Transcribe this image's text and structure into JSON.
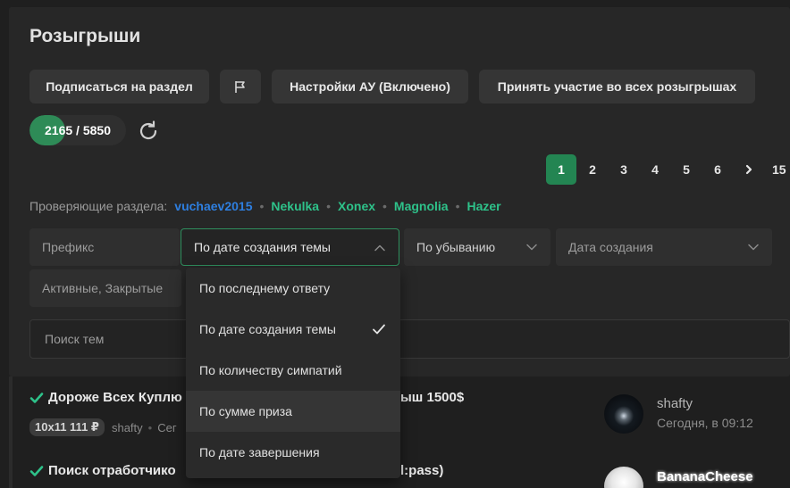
{
  "section": {
    "title": "Розыгрыши"
  },
  "actions": {
    "subscribe_label": "Подписаться на раздел",
    "flag_icon": "flag-icon",
    "auto_label": "Настройки АУ (Включено)",
    "join_all_label": "Принять участие во всех розыгрышах"
  },
  "counter": {
    "text": "2165 / 5850",
    "progress_fraction": 0.37,
    "refresh_icon": "refresh-icon"
  },
  "pagination": {
    "pages": [
      "1",
      "2",
      "3",
      "4",
      "5",
      "6"
    ],
    "active": "1",
    "next_icon": "chevron-right-icon",
    "last_partial": "15"
  },
  "moderators": {
    "label": "Проверяющие раздела:",
    "names": [
      {
        "name": "vuchaev2015",
        "color": "#2e7fe0"
      },
      {
        "name": "Nekulka",
        "color": "#2ec28a"
      },
      {
        "name": "Xonex",
        "color": "#2ec28a"
      },
      {
        "name": "Magnolia",
        "color": "#2ec28a"
      },
      {
        "name": "Hazer",
        "color": "#2ec28a"
      }
    ]
  },
  "filters": {
    "prefix_placeholder": "Префикс",
    "sort_value": "По дате создания темы",
    "order_value": "По убыванию",
    "date_placeholder": "Дата создания",
    "state_value": "Активные, Закрытые",
    "search_placeholder": "Поиск тем"
  },
  "sort_dropdown": {
    "options": [
      {
        "label": "По последнему ответу"
      },
      {
        "label": "По дате создания темы",
        "selected": true
      },
      {
        "label": "По количеству симпатий"
      },
      {
        "label": "По сумме приза",
        "hovered": true
      },
      {
        "label": "По дате завершения"
      }
    ]
  },
  "threads": [
    {
      "title_left": "Дороже Всех Куплю",
      "title_right": "ыш 1500$",
      "price": "10x11 111 ₽",
      "author": "shafty",
      "extra": "Сег",
      "last_user": "shafty",
      "last_time": "Сегодня, в 09:12"
    },
    {
      "title_left": "Поиск отработчико",
      "title_right": "l:pass)",
      "last_user": "BananaCheese"
    }
  ],
  "colors": {
    "accent": "#238552",
    "panel": "#272727",
    "background": "#1f1f1f"
  }
}
